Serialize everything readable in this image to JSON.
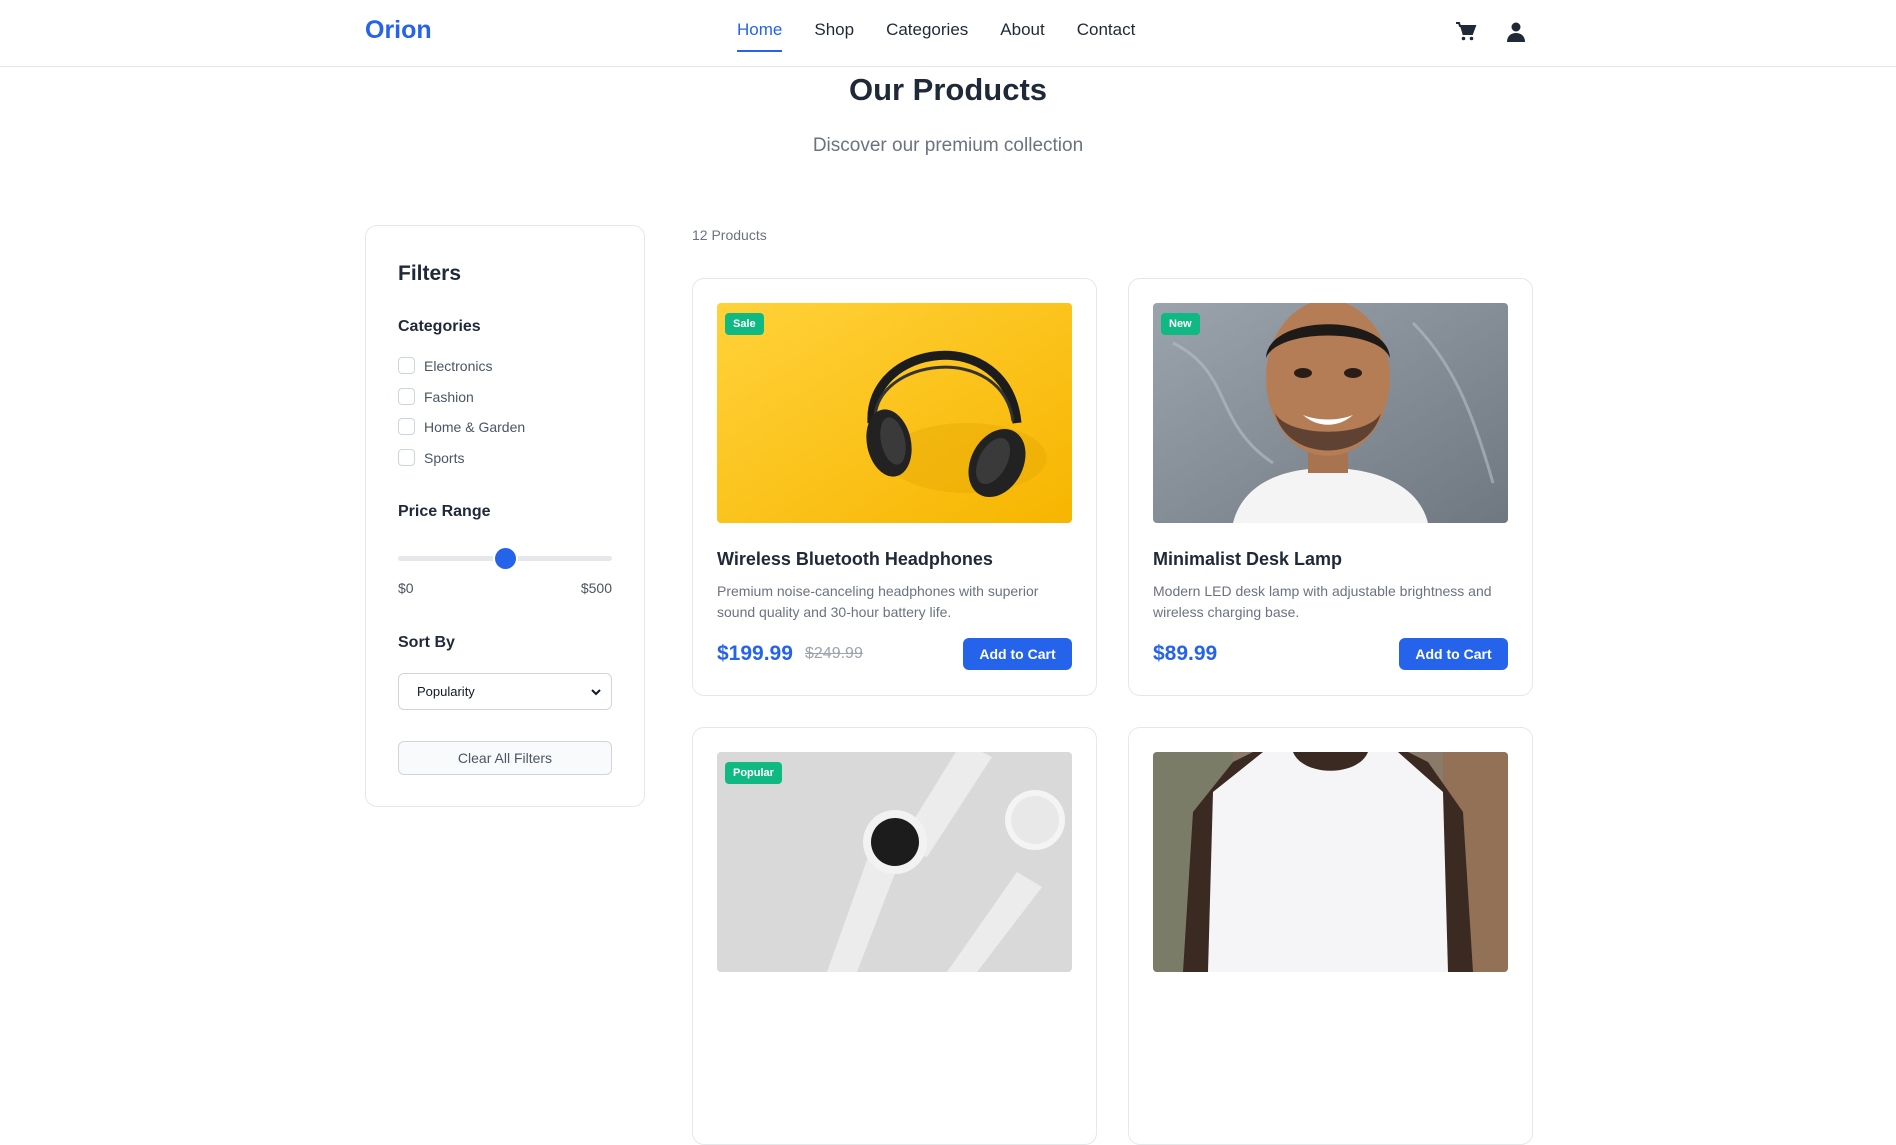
{
  "brand": {
    "name": "Orion",
    "accent": "#2563eb"
  },
  "nav": {
    "links": [
      {
        "label": "Home",
        "active": true
      },
      {
        "label": "Shop",
        "active": false
      },
      {
        "label": "Categories",
        "active": false
      },
      {
        "label": "About",
        "active": false
      },
      {
        "label": "Contact",
        "active": false
      }
    ],
    "icons": [
      "cart-icon",
      "user-icon"
    ]
  },
  "hero": {
    "title": "Our Products",
    "subtitle": "Discover our premium collection"
  },
  "filters": {
    "title": "Filters",
    "categories_label": "Categories",
    "categories": [
      {
        "label": "Electronics",
        "checked": false
      },
      {
        "label": "Fashion",
        "checked": false
      },
      {
        "label": "Home & Garden",
        "checked": false
      },
      {
        "label": "Sports",
        "checked": false
      }
    ],
    "price_label": "Price Range",
    "price_min": "$0",
    "price_max": "$500",
    "price_value_fraction": 0.5,
    "sort_label": "Sort By",
    "sort_selected": "Popularity",
    "clear_label": "Clear All Filters"
  },
  "products": {
    "count_label": "12 Products",
    "items": [
      {
        "badge": "Sale",
        "badge_color": "#10b981",
        "title": "Wireless Bluetooth Headphones",
        "description": "Premium noise-canceling headphones with superior sound quality and 30-hour battery life.",
        "price": "$199.99",
        "old_price": "$249.99",
        "button": "Add to Cart"
      },
      {
        "badge": "New",
        "badge_color": "#10b981",
        "title": "Minimalist Desk Lamp",
        "description": "Modern LED desk lamp with adjustable brightness and wireless charging base.",
        "price": "$89.99",
        "old_price": "",
        "button": "Add to Cart"
      },
      {
        "badge": "Popular",
        "badge_color": "#10b981"
      },
      {
        "badge": ""
      }
    ]
  }
}
